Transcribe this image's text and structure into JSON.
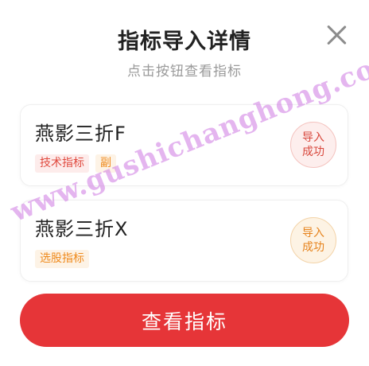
{
  "modal": {
    "title": "指标导入详情",
    "subtitle": "点击按钮查看指标",
    "close_icon": "close-icon"
  },
  "items": [
    {
      "name": "燕影三折F",
      "tags": [
        "技术指标",
        "副"
      ],
      "status_line1": "导入",
      "status_line2": "成功",
      "accent": "#e04a3f"
    },
    {
      "name": "燕影三折X",
      "tags": [
        "选股指标"
      ],
      "status_line1": "导入",
      "status_line2": "成功",
      "accent": "#ef8a1c"
    }
  ],
  "primary_button": {
    "label": "查看指标",
    "color": "#e63538"
  },
  "watermark": {
    "text": "www.gushichanghong.com"
  }
}
